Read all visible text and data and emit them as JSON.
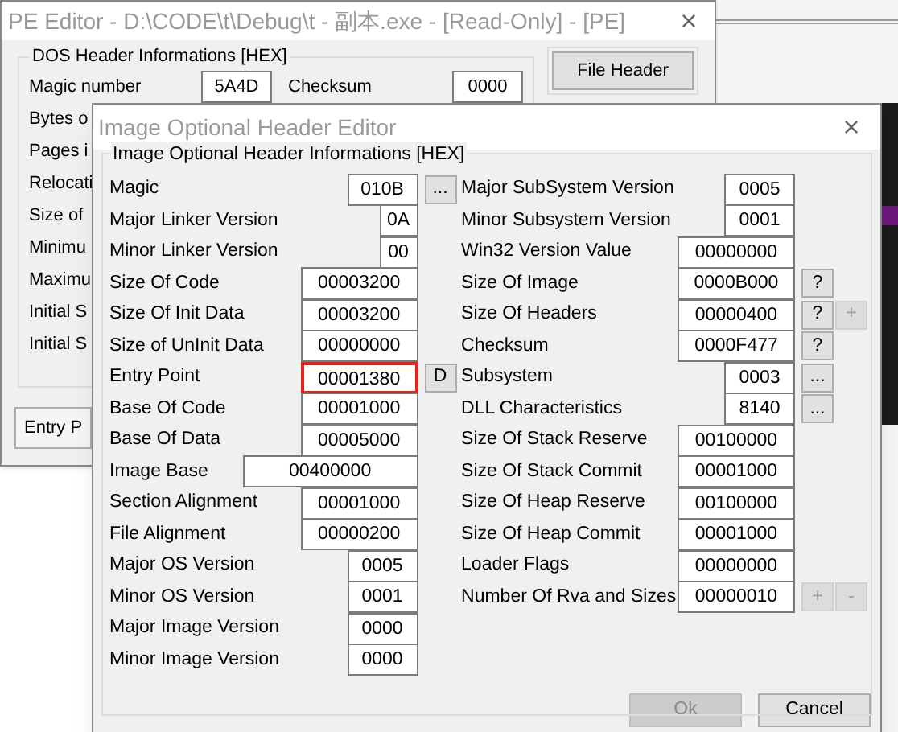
{
  "main_window": {
    "title": "PE Editor - D:\\CODE\\t\\Debug\\t - 副本.exe - [Read-Only] - [PE]",
    "close": "×",
    "group_title": "DOS Header Informations [HEX]",
    "fields": [
      {
        "label": "Magic number",
        "value": "5A4D"
      },
      {
        "label": "Checksum",
        "value": "0000"
      },
      {
        "label": "Bytes o"
      },
      {
        "label": "Pages i"
      },
      {
        "label": "Relocati"
      },
      {
        "label": "Size of"
      },
      {
        "label": "Minimu"
      },
      {
        "label": "Maximu"
      },
      {
        "label": "Initial S"
      },
      {
        "label": "Initial S"
      }
    ],
    "buttons": [
      "File Header",
      "Entry P"
    ]
  },
  "dialog": {
    "title": "Image Optional Header Editor",
    "close": "×",
    "group_title": "Image Optional Header Informations [HEX]",
    "left_fields": [
      {
        "label": "Magic",
        "value": "010B",
        "kind": "word",
        "buttons": [
          {
            "label": "...",
            "disabled": false
          }
        ]
      },
      {
        "label": "Major Linker Version",
        "value": "0A",
        "kind": "byte"
      },
      {
        "label": "Minor Linker Version",
        "value": "00",
        "kind": "byte"
      },
      {
        "label": "Size Of Code",
        "value": "00003200",
        "kind": "dword"
      },
      {
        "label": "Size Of Init Data",
        "value": "00003200",
        "kind": "dword"
      },
      {
        "label": "Size of UnInit Data",
        "value": "00000000",
        "kind": "dword"
      },
      {
        "label": "Entry Point",
        "value": "00001380",
        "kind": "dword",
        "highlighted": true,
        "buttons": [
          {
            "label": "D",
            "disabled": false
          }
        ]
      },
      {
        "label": "Base Of Code",
        "value": "00001000",
        "kind": "dword"
      },
      {
        "label": "Base Of Data",
        "value": "00005000",
        "kind": "dword"
      },
      {
        "label": "Image Base",
        "value": "00400000",
        "kind": "wide"
      },
      {
        "label": "Section Alignment",
        "value": "00001000",
        "kind": "dword"
      },
      {
        "label": "File Alignment",
        "value": "00000200",
        "kind": "dword"
      },
      {
        "label": "Major OS Version",
        "value": "0005",
        "kind": "word"
      },
      {
        "label": "Minor OS Version",
        "value": "0001",
        "kind": "word"
      },
      {
        "label": "Major Image Version",
        "value": "0000",
        "kind": "word"
      },
      {
        "label": "Minor Image Version",
        "value": "0000",
        "kind": "word"
      }
    ],
    "right_fields": [
      {
        "label": "Major SubSystem Version",
        "value": "0005",
        "kind": "word"
      },
      {
        "label": "Minor Subsystem Version",
        "value": "0001",
        "kind": "word"
      },
      {
        "label": "Win32 Version Value",
        "value": "00000000",
        "kind": "dword"
      },
      {
        "label": "Size Of Image",
        "value": "0000B000",
        "kind": "dword",
        "buttons": [
          {
            "label": "?",
            "disabled": false
          }
        ]
      },
      {
        "label": "Size Of Headers",
        "value": "00000400",
        "kind": "dword",
        "buttons": [
          {
            "label": "?",
            "disabled": false
          },
          {
            "label": "+",
            "disabled": true
          }
        ]
      },
      {
        "label": "Checksum",
        "value": "0000F477",
        "kind": "dword",
        "buttons": [
          {
            "label": "?",
            "disabled": false
          }
        ]
      },
      {
        "label": "Subsystem",
        "value": "0003",
        "kind": "word",
        "buttons": [
          {
            "label": "...",
            "disabled": false
          }
        ]
      },
      {
        "label": "DLL Characteristics",
        "value": "8140",
        "kind": "word",
        "buttons": [
          {
            "label": "...",
            "disabled": false
          }
        ]
      },
      {
        "label": "Size Of Stack Reserve",
        "value": "00100000",
        "kind": "dword"
      },
      {
        "label": "Size Of Stack Commit",
        "value": "00001000",
        "kind": "dword"
      },
      {
        "label": "Size Of Heap Reserve",
        "value": "00100000",
        "kind": "dword"
      },
      {
        "label": "Size Of Heap Commit",
        "value": "00001000",
        "kind": "dword"
      },
      {
        "label": "Loader Flags",
        "value": "00000000",
        "kind": "dword"
      },
      {
        "label": "Number Of Rva and Sizes",
        "value": "00000010",
        "kind": "dword",
        "buttons": [
          {
            "label": "+",
            "disabled": true
          },
          {
            "label": "-",
            "disabled": true
          }
        ]
      }
    ],
    "footer_buttons": [
      {
        "label": "Ok",
        "disabled": true
      },
      {
        "label": "Cancel",
        "disabled": false
      }
    ]
  }
}
